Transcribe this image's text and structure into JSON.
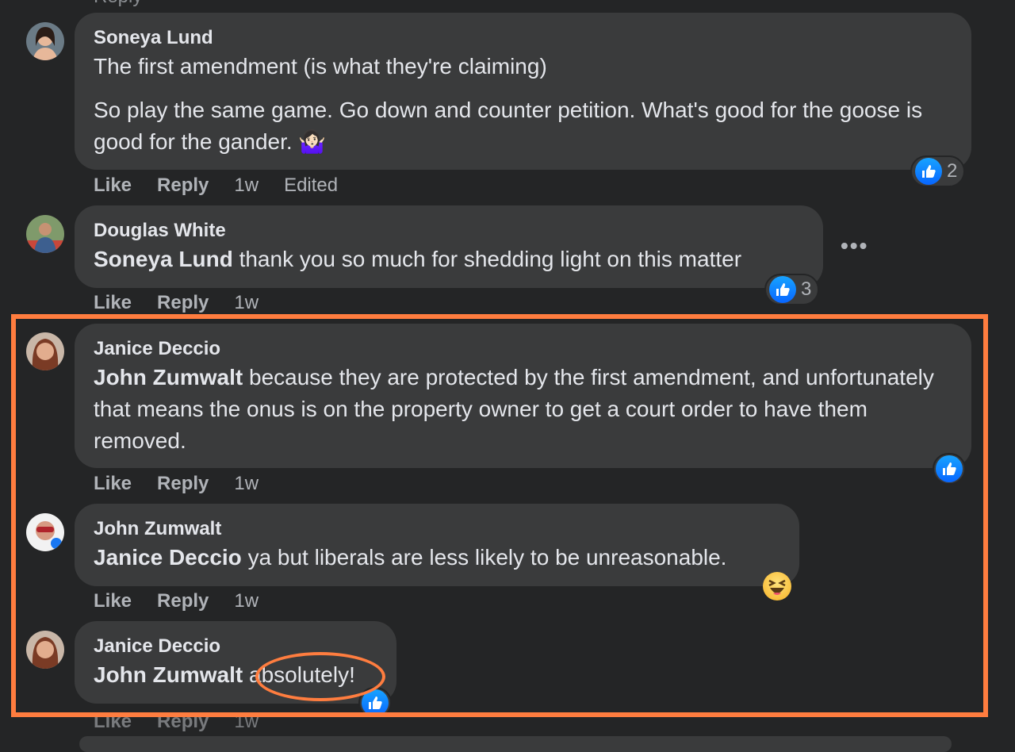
{
  "colors": {
    "background": "#242526",
    "bubble": "#3a3b3c",
    "text": "#e4e6eb",
    "muted": "#b0b3b8",
    "like_blue": "#0866ff",
    "annotation_orange": "#ff7d3f"
  },
  "top_ghost": "Reply",
  "comments": [
    {
      "author": "Soneya Lund",
      "lines": [
        "The first amendment (is what they're claiming)",
        "So play the same game. Go down and counter petition. What's good for the goose is good for the gander. 🤷🏻‍♀️"
      ],
      "actions": {
        "like": "Like",
        "reply": "Reply",
        "time": "1w",
        "edited": "Edited"
      },
      "reaction": {
        "icon": "like-icon",
        "count": "2"
      }
    },
    {
      "author": "Douglas White",
      "mention": "Soneya Lund",
      "text": "thank you so much for shedding light on this matter",
      "actions": {
        "like": "Like",
        "reply": "Reply",
        "time": "1w"
      },
      "reaction": {
        "icon": "like-icon",
        "count": "3"
      },
      "more": "•••"
    },
    {
      "author": "Janice Deccio",
      "mention": "John Zumwalt",
      "text": "because they are protected by the first amendment, and unfortunately that means the onus is on the property owner to get a court order to have them removed.",
      "actions": {
        "like": "Like",
        "reply": "Reply",
        "time": "1w"
      },
      "reaction": {
        "icon": "like-icon"
      }
    },
    {
      "author": "John Zumwalt",
      "mention": "Janice Deccio",
      "text": "ya but liberals are less likely to be unreasonable.",
      "actions": {
        "like": "Like",
        "reply": "Reply",
        "time": "1w"
      },
      "reaction": {
        "icon": "haha-icon"
      }
    },
    {
      "author": "Janice Deccio",
      "mention": "John Zumwalt",
      "text": "absolutely!",
      "actions": {
        "like": "Like",
        "reply": "Reply",
        "time": "1w"
      },
      "reaction": {
        "icon": "like-icon"
      }
    }
  ]
}
